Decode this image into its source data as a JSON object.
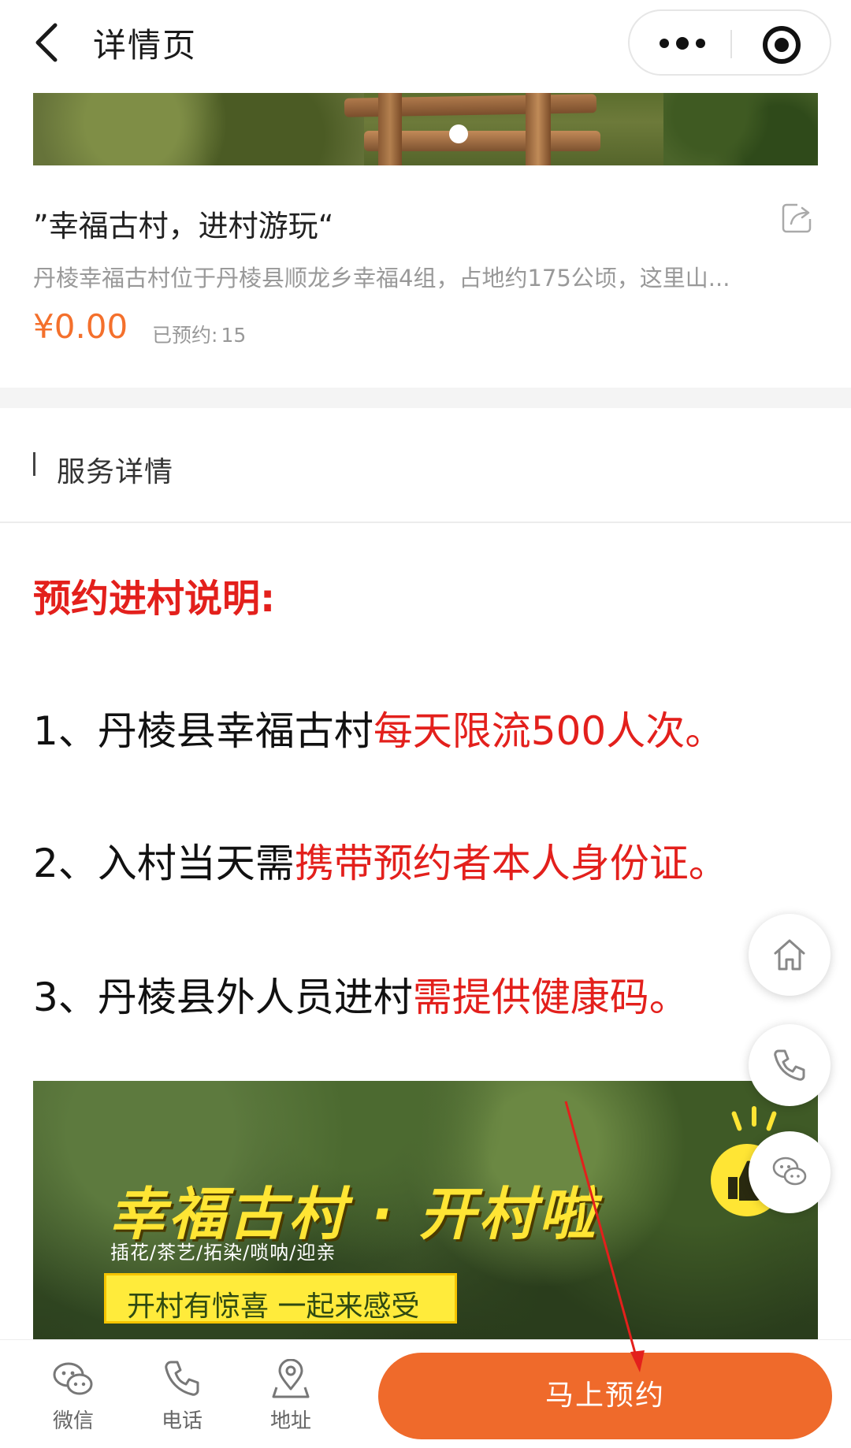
{
  "nav": {
    "title": "详情页"
  },
  "product": {
    "title": "”幸福古村，进村游玩“",
    "description": "丹棱幸福古村位于丹棱县顺龙乡幸福4组，占地约175公顷，这里山...",
    "price": "¥0.00",
    "booked_label": "已预约:",
    "booked_count": "15"
  },
  "section": {
    "title": "服务详情"
  },
  "content": {
    "notice_title": "预约进村说明:",
    "rules": [
      {
        "prefix": "1、丹棱县幸福古村",
        "highlight": "每天限流500人次。"
      },
      {
        "prefix": "2、入村当天需",
        "highlight": "携带预约者本人身份证。"
      },
      {
        "prefix": "3、丹棱县外人员进村",
        "highlight": "需提供健康码。"
      }
    ]
  },
  "banner": {
    "title": "幸福古村 · 开村啦",
    "subtitle": "插花/茶艺/拓染/唢呐/迎亲",
    "tagline": "开村有惊喜 一起来感受"
  },
  "bottom_bar": {
    "tabs": [
      {
        "label": "微信",
        "icon": "wechat-icon"
      },
      {
        "label": "电话",
        "icon": "phone-icon"
      },
      {
        "label": "地址",
        "icon": "location-icon"
      }
    ],
    "cta_label": "马上预约"
  },
  "colors": {
    "accent": "#ef6a2b",
    "price": "#f4702c",
    "highlight_red": "#e3201c"
  }
}
